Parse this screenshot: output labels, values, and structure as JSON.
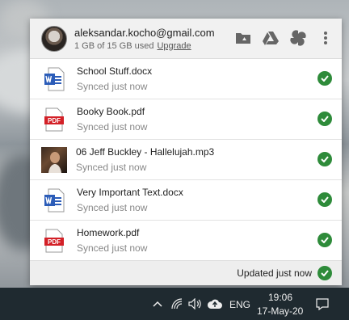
{
  "account": {
    "email": "aleksandar.kocho@gmail.com",
    "usage": "1 GB of 15 GB used",
    "upgrade_label": "Upgrade"
  },
  "header_icons": [
    "drive-folder-icon",
    "google-drive-icon",
    "google-photos-icon",
    "more-vert-icon"
  ],
  "files": [
    {
      "name": "School Stuff.docx",
      "status": "Synced just now",
      "type": "word"
    },
    {
      "name": "Booky Book.pdf",
      "status": "Synced just now",
      "type": "pdf"
    },
    {
      "name": "06 Jeff Buckley - Hallelujah.mp3",
      "status": "Synced just now",
      "type": "audio"
    },
    {
      "name": "Very Important Text.docx",
      "status": "Synced just now",
      "type": "word"
    },
    {
      "name": "Homework.pdf",
      "status": "Synced just now",
      "type": "pdf"
    }
  ],
  "footer": {
    "status": "Updated just now"
  },
  "taskbar": {
    "language": "ENG",
    "time": "19:06",
    "date": "17-May-20"
  },
  "file_type_labels": {
    "pdf": "PDF"
  },
  "colors": {
    "check_green": "#2e8b3a",
    "word_blue": "#2b5cb8",
    "pdf_red": "#d32027"
  }
}
